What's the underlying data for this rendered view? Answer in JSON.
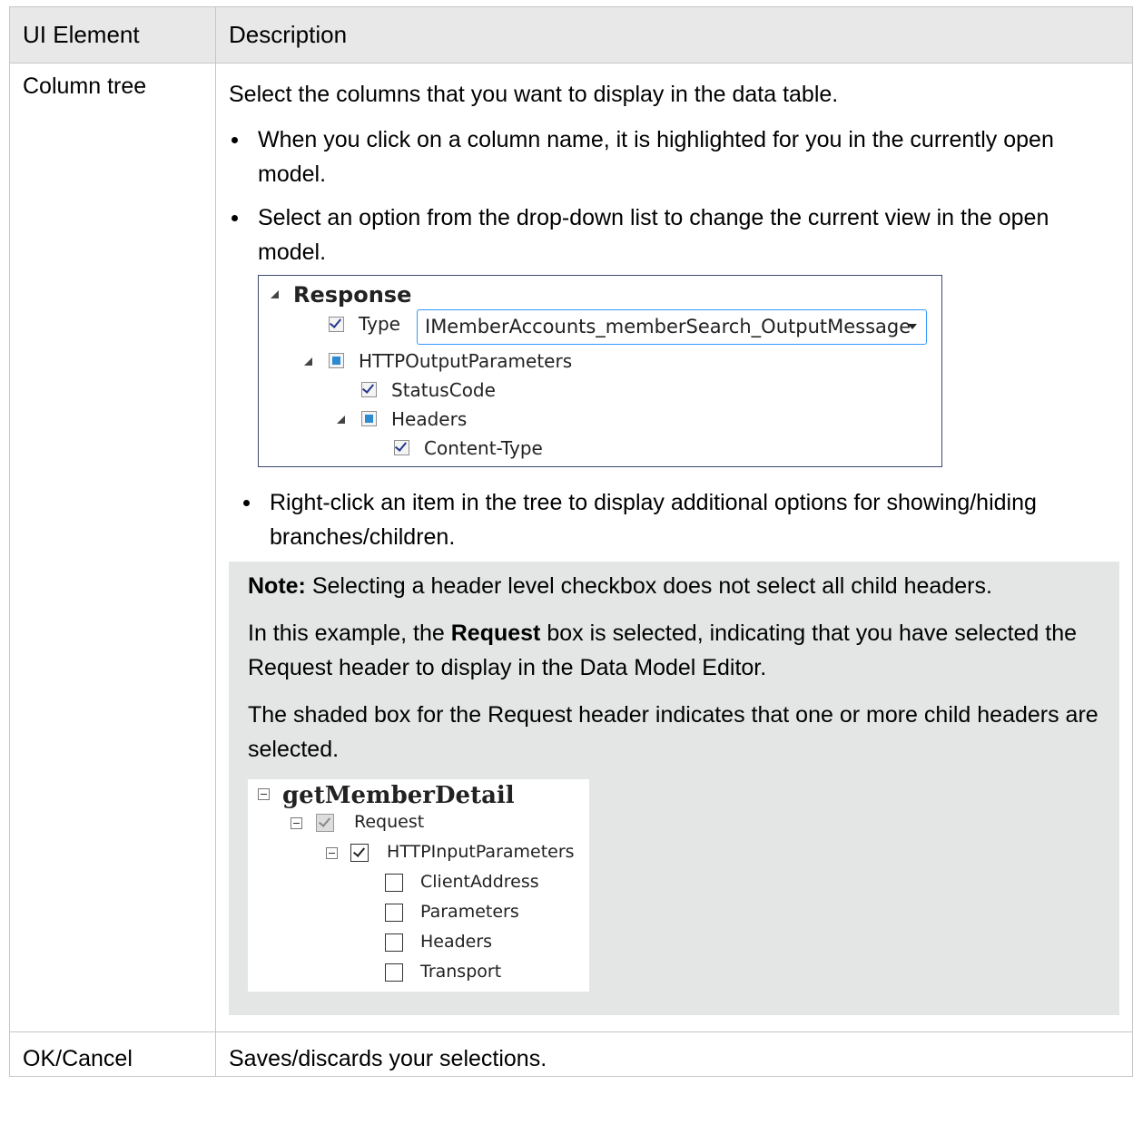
{
  "table": {
    "header": {
      "col1": "UI Element",
      "col2": "Description"
    },
    "row1": {
      "element": "Column tree",
      "intro": "Select the columns that you want to display in the data table.",
      "bullets": [
        "When you click on a column name, it is highlighted for you in the currently open model.",
        "Select an option from the drop-down list to change the current view in the open model.",
        "Right-click an item in the tree to display additional options for showing/hiding branches/children."
      ],
      "tree1": {
        "response": "Response",
        "type_label": "Type",
        "type_value": "IMemberAccounts_memberSearch_OutputMessage",
        "http_output": "HTTPOutputParameters",
        "status_code": "StatusCode",
        "headers": "Headers",
        "content_type": "Content-Type"
      },
      "note": {
        "label": "Note:",
        "text1": " Selecting a header level checkbox does not select all child headers.",
        "p2_pre": "In this example, the ",
        "p2_bold": "Request",
        "p2_post": " box is selected, indicating that you have selected the Request header to display in the Data Model Editor.",
        "p3": "The shaded box for the Request header indicates that one or more child headers are selected."
      },
      "tree2": {
        "root": "getMemberDetail",
        "request": "Request",
        "http_input": "HTTPInputParameters",
        "children": [
          "ClientAddress",
          "Parameters",
          "Headers",
          "Transport"
        ]
      }
    },
    "row2": {
      "element": "OK/Cancel",
      "description": "Saves/discards your selections."
    }
  }
}
